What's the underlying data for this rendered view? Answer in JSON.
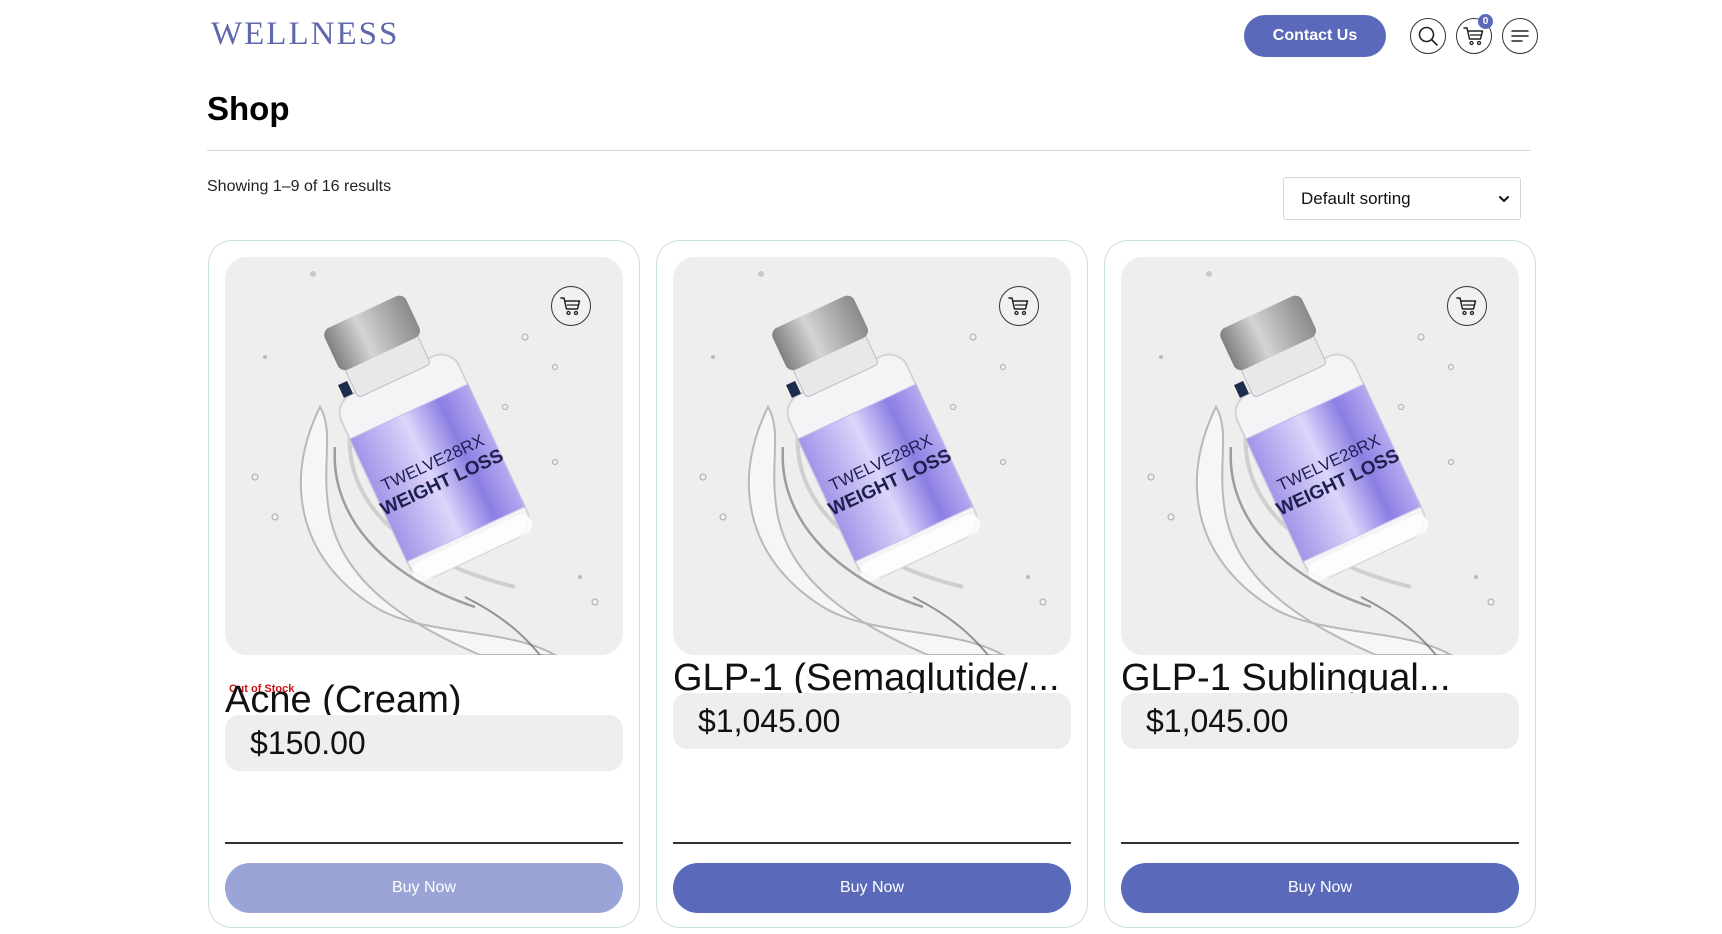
{
  "header": {
    "logo": "WELLNESS",
    "contact_label": "Contact Us",
    "cart_count": "0",
    "icons": [
      "search-icon",
      "cart-icon",
      "menu-icon"
    ]
  },
  "shop": {
    "title": "Shop",
    "result_count": "Showing 1–9 of 16 results",
    "sort_selected": "Default sorting"
  },
  "products": [
    {
      "stock_status": "Out of Stock",
      "name": "Acne (Cream)",
      "price": "$150.00",
      "buy_label": "Buy Now",
      "label_line1": "TWELVE28RX",
      "label_line2": "WEIGHT LOSS",
      "disabled": true
    },
    {
      "stock_status": "",
      "name": "GLP-1 (Semaglutide/...",
      "price": "$1,045.00",
      "buy_label": "Buy Now",
      "label_line1": "TWELVE28RX",
      "label_line2": "WEIGHT LOSS",
      "disabled": false
    },
    {
      "stock_status": "",
      "name": "GLP-1 Sublingual...",
      "price": "$1,045.00",
      "buy_label": "Buy Now",
      "label_line1": "TWELVE28RX",
      "label_line2": "WEIGHT LOSS",
      "disabled": false
    }
  ],
  "colors": {
    "accent": "#5b69bb",
    "accent_disabled": "#9aa4d6",
    "stock_red": "#d01010",
    "card_border": "#c9dfe5",
    "tile_bg": "#eeeeee"
  }
}
